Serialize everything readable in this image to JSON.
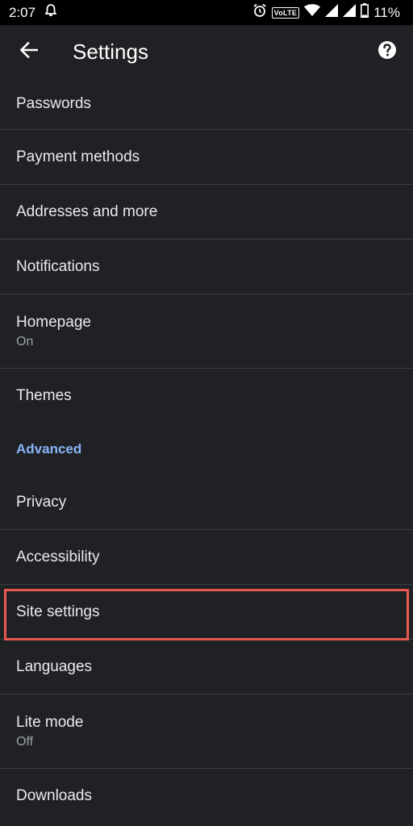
{
  "status_bar": {
    "time": "2:07",
    "network_badge": "VoLTE",
    "battery": "11%",
    "icons": [
      "notification-bell-icon",
      "alarm-clock-icon",
      "wifi-icon",
      "cell-signal-icon",
      "cell-signal-icon",
      "battery-icon"
    ]
  },
  "app_bar": {
    "title": "Settings",
    "back_icon": "arrow-back-icon",
    "help_icon": "help-circle-icon"
  },
  "settings": {
    "passwords": "Passwords",
    "payment_methods": "Payment methods",
    "addresses": "Addresses and more",
    "notifications": "Notifications",
    "homepage": "Homepage",
    "homepage_status": "On",
    "themes": "Themes",
    "advanced_header": "Advanced",
    "privacy": "Privacy",
    "accessibility": "Accessibility",
    "site_settings": "Site settings",
    "languages": "Languages",
    "lite_mode": "Lite mode",
    "lite_mode_status": "Off",
    "downloads": "Downloads"
  },
  "colors": {
    "background": "#202124",
    "status_bar": "#000000",
    "divider": "#3c4043",
    "section_header": "#8ab4f8",
    "highlight": "#e8584f"
  }
}
